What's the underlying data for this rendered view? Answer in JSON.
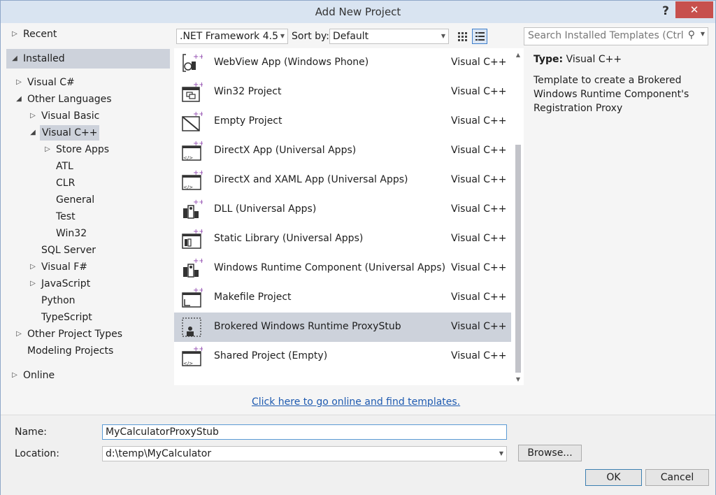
{
  "window": {
    "title": "Add New Project",
    "help": "?",
    "close": "✕"
  },
  "tree": {
    "recent": "Recent",
    "installed": "Installed",
    "visual_csharp": "Visual C#",
    "other_languages": "Other Languages",
    "visual_basic": "Visual Basic",
    "visual_cpp": "Visual C++",
    "store_apps": "Store Apps",
    "atl": "ATL",
    "clr": "CLR",
    "general": "General",
    "test": "Test",
    "win32": "Win32",
    "sql_server": "SQL Server",
    "visual_fsharp": "Visual F#",
    "javascript": "JavaScript",
    "python": "Python",
    "typescript": "TypeScript",
    "other_project_types": "Other Project Types",
    "modeling_projects": "Modeling Projects",
    "online": "Online"
  },
  "toolbar": {
    "framework": ".NET Framework 4.5",
    "sort_by_label": "Sort by:",
    "sort_value": "Default",
    "search_placeholder": "Search Installed Templates (Ctrl+E)"
  },
  "templates": [
    {
      "name": "WebView App (Windows Phone)",
      "lang": "Visual C++",
      "icon": "webview-template-icon"
    },
    {
      "name": "Win32 Project",
      "lang": "Visual C++",
      "icon": "win32-template-icon"
    },
    {
      "name": "Empty Project",
      "lang": "Visual C++",
      "icon": "empty-project-template-icon"
    },
    {
      "name": "DirectX App (Universal Apps)",
      "lang": "Visual C++",
      "icon": "directx-app-template-icon"
    },
    {
      "name": "DirectX and XAML App (Universal Apps)",
      "lang": "Visual C++",
      "icon": "directx-xaml-template-icon"
    },
    {
      "name": "DLL (Universal Apps)",
      "lang": "Visual C++",
      "icon": "dll-template-icon"
    },
    {
      "name": "Static Library (Universal Apps)",
      "lang": "Visual C++",
      "icon": "static-library-template-icon"
    },
    {
      "name": "Windows Runtime Component (Universal Apps)",
      "lang": "Visual C++",
      "icon": "winrt-component-template-icon"
    },
    {
      "name": "Makefile Project",
      "lang": "Visual C++",
      "icon": "makefile-template-icon"
    },
    {
      "name": "Brokered Windows Runtime ProxyStub",
      "lang": "Visual C++",
      "icon": "proxystub-template-icon",
      "selected": true
    },
    {
      "name": "Shared Project (Empty)",
      "lang": "Visual C++",
      "icon": "shared-project-template-icon"
    }
  ],
  "online_link": "Click here to go online and find templates.",
  "details": {
    "type_label": "Type:",
    "type_value": "Visual C++",
    "description": "Template to create a Brokered Windows Runtime Component's Registration Proxy"
  },
  "form": {
    "name_label": "Name:",
    "name_value": "MyCalculatorProxyStub",
    "location_label": "Location:",
    "location_value": "d:\\temp\\MyCalculator",
    "browse": "Browse...",
    "ok": "OK",
    "cancel": "Cancel"
  },
  "colors": {
    "accent": "#3e7ecb",
    "selection": "#cdd2db",
    "close": "#c7504d",
    "link": "#1e5ab0",
    "plus": "#8e44ad"
  }
}
